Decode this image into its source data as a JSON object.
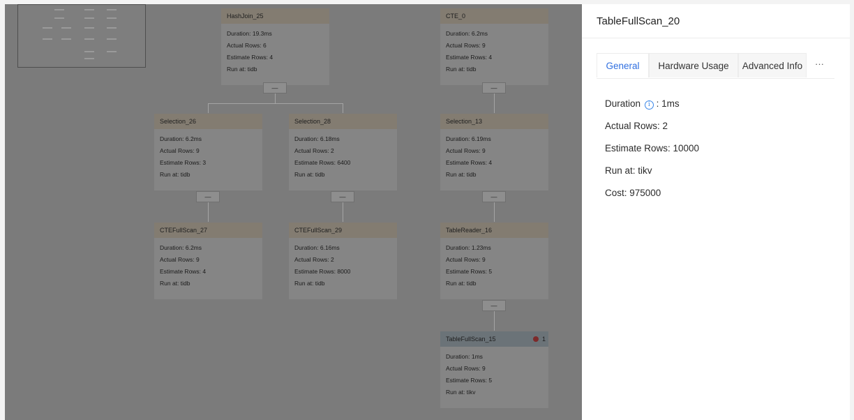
{
  "plan": {
    "nodes": [
      {
        "title": "HashJoin_25",
        "duration": "Duration: 19.3ms",
        "actual": "Actual Rows: 6",
        "estimate": "Estimate Rows: 4",
        "run": "Run at: tidb"
      },
      {
        "title": "CTE_0",
        "duration": "Duration: 6.2ms",
        "actual": "Actual Rows: 9",
        "estimate": "Estimate Rows: 4",
        "run": "Run at: tidb"
      },
      {
        "title": "Selection_26",
        "duration": "Duration: 6.2ms",
        "actual": "Actual Rows: 9",
        "estimate": "Estimate Rows: 3",
        "run": "Run at: tidb"
      },
      {
        "title": "Selection_28",
        "duration": "Duration: 6.18ms",
        "actual": "Actual Rows: 2",
        "estimate": "Estimate Rows: 6400",
        "run": "Run at: tidb"
      },
      {
        "title": "Selection_13",
        "duration": "Duration: 6.19ms",
        "actual": "Actual Rows: 9",
        "estimate": "Estimate Rows: 4",
        "run": "Run at: tidb"
      },
      {
        "title": "CTEFullScan_27",
        "duration": "Duration: 6.2ms",
        "actual": "Actual Rows: 9",
        "estimate": "Estimate Rows: 4",
        "run": "Run at: tidb"
      },
      {
        "title": "CTEFullScan_29",
        "duration": "Duration: 6.16ms",
        "actual": "Actual Rows: 2",
        "estimate": "Estimate Rows: 8000",
        "run": "Run at: tidb"
      },
      {
        "title": "TableReader_16",
        "duration": "Duration: 1.23ms",
        "actual": "Actual Rows: 9",
        "estimate": "Estimate Rows: 5",
        "run": "Run at: tidb"
      },
      {
        "title": "TableFullScan_15",
        "duration": "Duration: 1ms",
        "actual": "Actual Rows: 9",
        "estimate": "Estimate Rows: 5",
        "run": "Run at: tikv",
        "warnings": "1"
      }
    ],
    "collapse_label": "—"
  },
  "panel": {
    "title": "TableFullScan_20",
    "tabs": [
      "General",
      "Hardware Usage",
      "Advanced Info"
    ],
    "more": "···",
    "duration_label": "Duration",
    "duration_value": ": 1ms",
    "actual_rows": "Actual Rows: 2",
    "estimate_rows": "Estimate Rows: 10000",
    "run_at": "Run at: tikv",
    "cost": "Cost: 975000"
  },
  "colors": {
    "accent": "#2f6fe0",
    "error": "#e04b4b",
    "info_icon": "#3a86e8"
  },
  "icons": {
    "info": "info-icon",
    "error": "error-dot-icon",
    "more": "more-icon"
  }
}
